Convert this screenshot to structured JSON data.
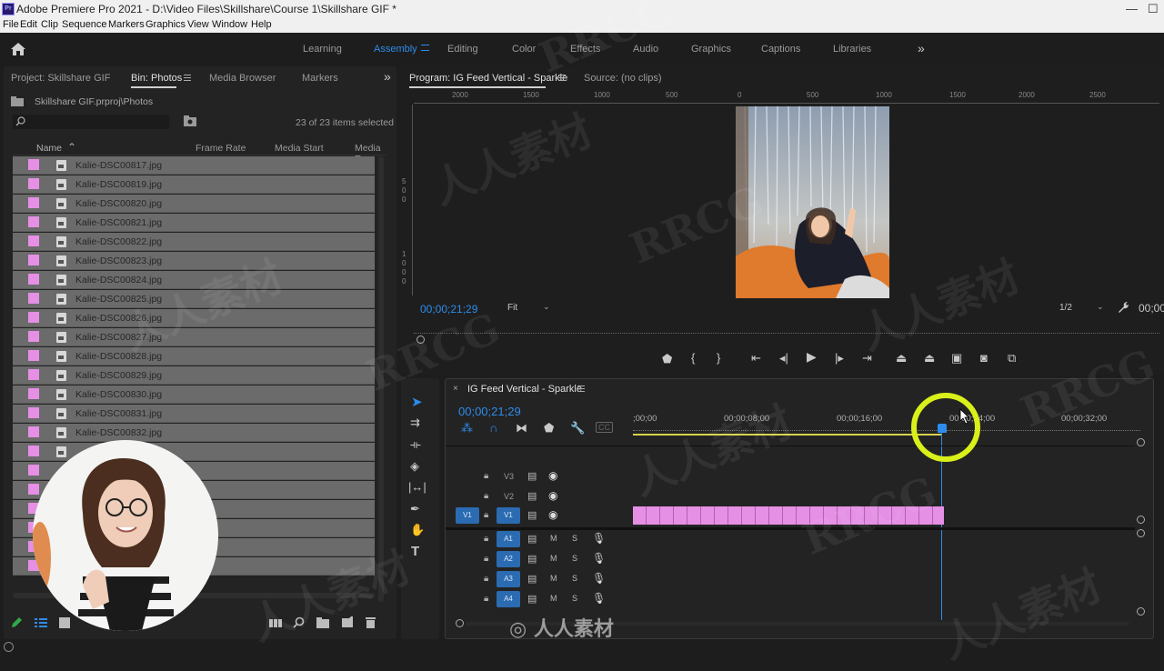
{
  "window": {
    "title": "Adobe Premiere Pro 2021 - D:\\Video Files\\Skillshare\\Course 1\\Skillshare GIF *",
    "app_icon": "Pr"
  },
  "menu": [
    "File",
    "Edit",
    "Clip",
    "Sequence",
    "Markers",
    "Graphics",
    "View",
    "Window",
    "Help"
  ],
  "workspaces": {
    "items": [
      "Learning",
      "Assembly",
      "Editing",
      "Color",
      "Effects",
      "Audio",
      "Graphics",
      "Captions",
      "Libraries"
    ],
    "active": "Assembly",
    "more": "»"
  },
  "project_panel": {
    "tabs": [
      "Project: Skillshare GIF",
      "Bin: Photos",
      "Media Browser",
      "Markers"
    ],
    "expand": "»",
    "path": "Skillshare GIF.prproj\\Photos",
    "selection_count": "23 of 23 items selected",
    "columns": [
      "Name",
      "Frame Rate",
      "Media Start",
      "Media E"
    ],
    "rows": [
      "Kalie-DSC00817.jpg",
      "Kalie-DSC00819.jpg",
      "Kalie-DSC00820.jpg",
      "Kalie-DSC00821.jpg",
      "Kalie-DSC00822.jpg",
      "Kalie-DSC00823.jpg",
      "Kalie-DSC00824.jpg",
      "Kalie-DSC00825.jpg",
      "Kalie-DSC00826.jpg",
      "Kalie-DSC00827.jpg",
      "Kalie-DSC00828.jpg",
      "Kalie-DSC00829.jpg",
      "Kalie-DSC00830.jpg",
      "Kalie-DSC00831.jpg",
      "Kalie-DSC00832.jpg"
    ],
    "label_color": "#e58fe5"
  },
  "program_monitor": {
    "tabs": [
      "Program: IG Feed Vertical - Sparkle",
      "Source: (no clips)"
    ],
    "ruler_labels": [
      "2000",
      "1500",
      "1000",
      "500",
      "0",
      "500",
      "1000",
      "1500",
      "2000",
      "2500"
    ],
    "vruler_labels": [
      "5",
      "0",
      "0",
      "1",
      "0",
      "0",
      "0"
    ],
    "timecode": "00;00;21;29",
    "zoom": "Fit",
    "resolution": "1/2",
    "timecode_right": "00;00"
  },
  "timeline": {
    "sequence_name": "IG Feed Vertical - Sparkle",
    "timecode": "00;00;21;29",
    "ruler_labels": [
      ";00;00",
      "00;00;08;00",
      "00;00;16;00",
      "00;00;24;00",
      "00;00;32;00"
    ],
    "video_tracks": [
      "V3",
      "V2",
      "V1"
    ],
    "source_patch": "V1",
    "audio_tracks": [
      "A1",
      "A2",
      "A3",
      "A4"
    ],
    "mute_label": "M",
    "solo_label": "S",
    "clip_color": "#e58fe5",
    "highlight_color": "#d9f01a"
  },
  "overlay": {
    "watermark": "RRCG",
    "watermark_cn": "人人素材"
  }
}
